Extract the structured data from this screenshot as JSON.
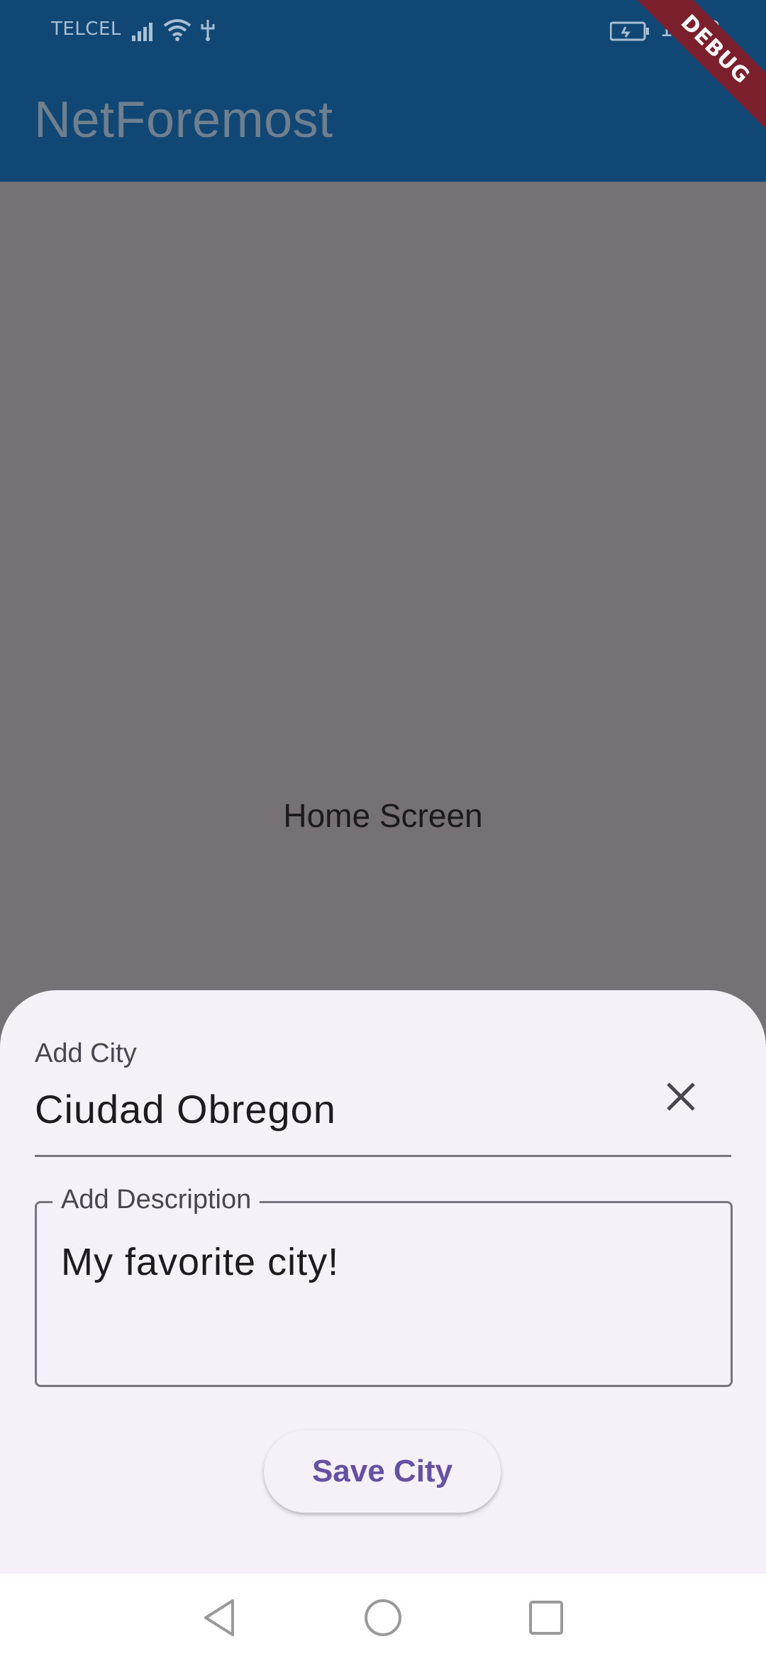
{
  "status_bar": {
    "carrier": "TELCEL",
    "time": "10:02",
    "icons": [
      "signal-icon",
      "wifi-icon",
      "usb-icon",
      "battery-charging-icon"
    ]
  },
  "app_bar": {
    "title": "NetForemost"
  },
  "debug_banner": "DEBUG",
  "home": {
    "text": "Home Screen"
  },
  "sheet": {
    "city_field": {
      "label": "Add City",
      "value": "Ciudad Obregon"
    },
    "description_field": {
      "label": "Add Description",
      "value": "My favorite city!"
    },
    "save_button": "Save City"
  },
  "colors": {
    "app_bar": "#104775",
    "scrim": "#767174",
    "sheet": "#f6f1f8",
    "accent": "#6650a4",
    "debug": "#7c1f2c"
  }
}
